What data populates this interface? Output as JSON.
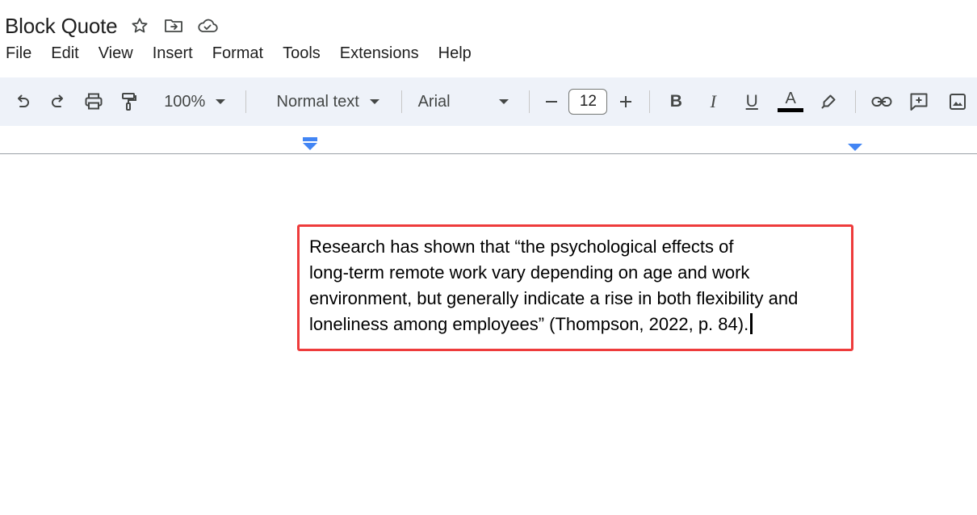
{
  "document": {
    "title": "Block Quote"
  },
  "title_icons": [
    "star-icon",
    "move-to-folder-icon",
    "cloud-saved-icon"
  ],
  "menu": [
    "File",
    "Edit",
    "View",
    "Insert",
    "Format",
    "Tools",
    "Extensions",
    "Help"
  ],
  "toolbar": {
    "zoom": "100%",
    "paragraph_style": "Normal text",
    "font": "Arial",
    "font_size": "12",
    "bold_label": "B",
    "italic_label": "I",
    "underline_label": "U",
    "text_color_label": "A",
    "text_color": "#000000",
    "icons": [
      "undo-icon",
      "redo-icon",
      "print-icon",
      "paint-format-icon",
      "minus-icon",
      "plus-icon",
      "highlighter-icon",
      "link-icon",
      "add-comment-icon",
      "insert-image-icon"
    ]
  },
  "ruler": {
    "indent_marker_color": "#4285f4"
  },
  "content": {
    "quote_lines": [
      "Research has shown that “the psychological effects of",
      "long-term remote work vary depending on age and work",
      "environment, but generally indicate a rise in both flexibility and",
      "loneliness among employees” (Thompson, 2022, p. 84)."
    ],
    "highlight_color": "#ee3b3b"
  }
}
